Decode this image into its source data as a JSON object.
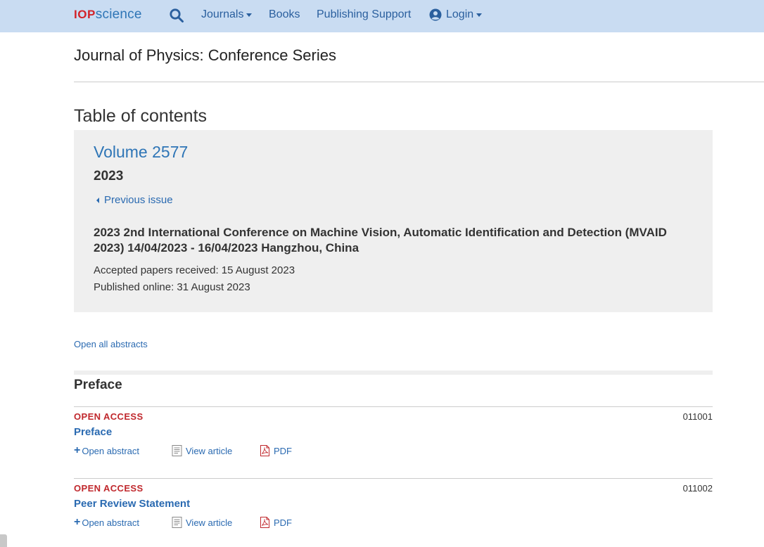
{
  "nav": {
    "logo_iop": "IOP",
    "logo_science": "science",
    "journals": "Journals",
    "books": "Books",
    "publishing_support": "Publishing Support",
    "login": "Login"
  },
  "journal_title": "Journal of Physics: Conference Series",
  "toc_heading": "Table of contents",
  "volume": {
    "title": "Volume 2577",
    "year": "2023",
    "previous_issue": "Previous issue",
    "conference": "2023 2nd International Conference on Machine Vision, Automatic Identification and Detection (MVAID 2023) 14/04/2023 - 16/04/2023 Hangzhou, China",
    "accepted": "Accepted papers received: 15 August 2023",
    "published": "Published online: 31 August 2023"
  },
  "open_all_abstracts": "Open all abstracts",
  "section": {
    "heading": "Preface",
    "articles": [
      {
        "access": "OPEN ACCESS",
        "number": "011001",
        "title": "Preface",
        "open_abstract": "Open abstract",
        "view_article": "View article",
        "pdf": "PDF"
      },
      {
        "access": "OPEN ACCESS",
        "number": "011002",
        "title": "Peer Review Statement",
        "open_abstract": "Open abstract",
        "view_article": "View article",
        "pdf": "PDF"
      }
    ]
  },
  "colors": {
    "topbar": "#c9dcf2",
    "link": "#2a6ab1",
    "open_access": "#c0282d",
    "panel": "#efefef"
  },
  "icons": {
    "search": "search-icon",
    "user": "user-circle-icon",
    "article": "document-icon",
    "pdf": "pdf-icon",
    "plus": "plus-icon"
  }
}
